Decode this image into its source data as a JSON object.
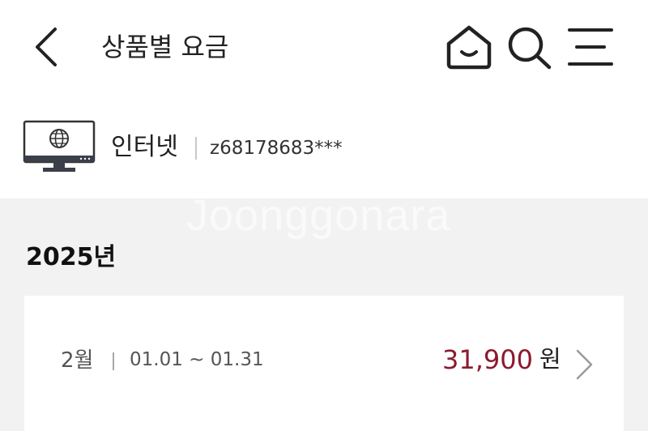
{
  "header": {
    "title": "상품별 요금",
    "back_icon": "chevron-left-icon",
    "home_icon": "home-icon",
    "search_icon": "search-icon",
    "menu_icon": "menu-icon"
  },
  "service": {
    "icon": "monitor-globe-icon",
    "name": "인터넷",
    "account": "z68178683***"
  },
  "watermark": "Joonggonara",
  "year": "2025년",
  "bills": [
    {
      "month": "2월",
      "period": "01.01 ~ 01.31",
      "amount": "31,900",
      "unit": "원",
      "detail_icon": "chevron-right-icon"
    }
  ],
  "colors": {
    "amount": "#8b1a2e",
    "section_background": "#f2f2f2",
    "card_background": "#ffffff"
  }
}
